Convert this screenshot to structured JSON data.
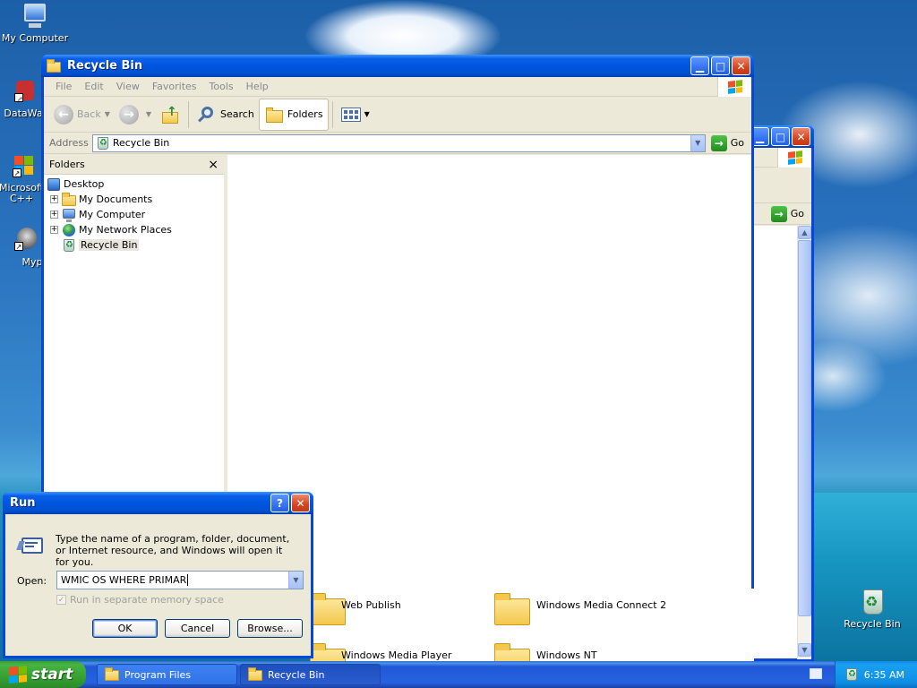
{
  "desktop": {
    "icons": [
      {
        "label": "My Computer",
        "icon": "my-computer-icon"
      },
      {
        "label": "DataWa",
        "icon": "shortcut-icon"
      },
      {
        "label": "Microsoft C++",
        "icon": "shortcut-icon"
      },
      {
        "label": "Myp",
        "icon": "shortcut-icon"
      },
      {
        "label": "Recycle Bin",
        "icon": "recycle-bin-icon"
      }
    ]
  },
  "back_window": {
    "go_label": "Go",
    "files": [
      {
        "label": "Web Publish"
      },
      {
        "label": "Windows Media Connect 2"
      },
      {
        "label": "Windows Media Player"
      },
      {
        "label": "Windows NT"
      }
    ]
  },
  "explorer": {
    "title": "Recycle Bin",
    "menu": [
      "File",
      "Edit",
      "View",
      "Favorites",
      "Tools",
      "Help"
    ],
    "toolbar": {
      "back_label": "Back",
      "search_label": "Search",
      "folders_label": "Folders"
    },
    "address": {
      "label": "Address",
      "value": "Recycle Bin",
      "go_label": "Go"
    },
    "folders_pane": {
      "header": "Folders",
      "close_glyph": "×",
      "items": [
        {
          "label": "Desktop",
          "icon": "desktop-icon",
          "expander": ""
        },
        {
          "label": "My Documents",
          "icon": "folder-icon",
          "expander": "+"
        },
        {
          "label": "My Computer",
          "icon": "computer-icon",
          "expander": "+"
        },
        {
          "label": "My Network Places",
          "icon": "network-icon",
          "expander": "+"
        },
        {
          "label": "Recycle Bin",
          "icon": "recycle-bin-icon",
          "expander": ""
        }
      ]
    }
  },
  "run_dialog": {
    "title": "Run",
    "help_glyph": "?",
    "description": "Type the name of a program, folder, document, or Internet resource, and Windows will open it for you.",
    "open_label": "Open:",
    "open_value": "WMIC OS WHERE PRIMAR",
    "checkbox_label": "Run in separate memory space",
    "ok_label": "OK",
    "cancel_label": "Cancel",
    "browse_label": "Browse..."
  },
  "taskbar": {
    "start_label": "start",
    "tasks": [
      {
        "label": "Program Files"
      },
      {
        "label": "Recycle Bin"
      }
    ],
    "clock": "6:35 AM"
  },
  "colors": {
    "title_blue": "#0054e3",
    "window_face": "#ece9d8",
    "close_red": "#d8431f",
    "start_green": "#36a132"
  }
}
